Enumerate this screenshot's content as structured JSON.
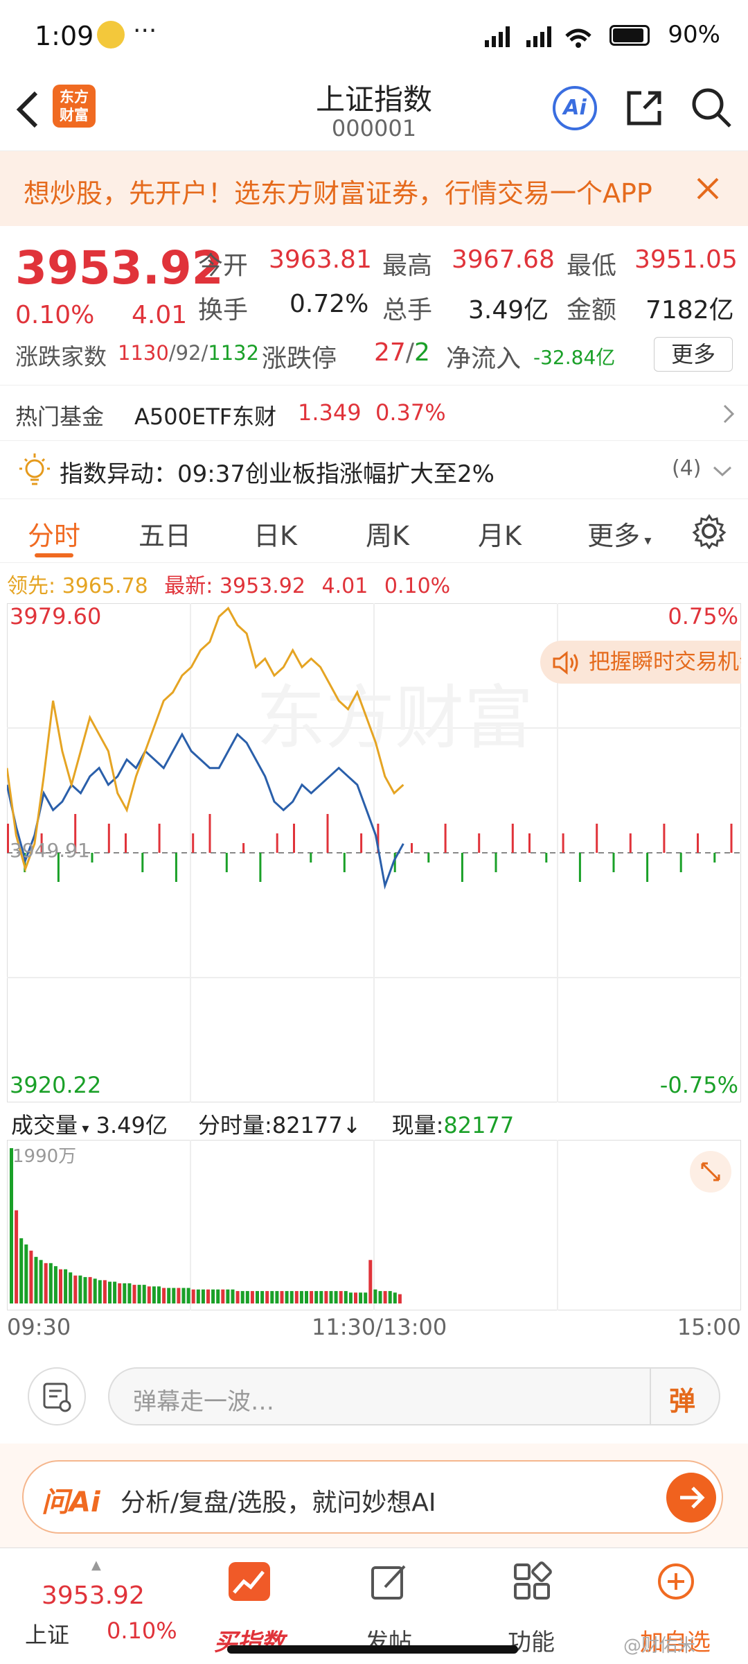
{
  "status_bar": {
    "time": "1:09",
    "dots": "···",
    "battery": "90%"
  },
  "header": {
    "back_icon": "chevron-left-icon",
    "logo_text": "东方\n财富",
    "title": "上证指数",
    "code": "000001",
    "ai_label": "Ai"
  },
  "banner": {
    "text": "想炒股，先开户！选东方财富证券，行情交易一个APP",
    "close_icon": "close-icon"
  },
  "quote": {
    "price": "3953.92",
    "change_pct": "0.10%",
    "change": "4.01",
    "open_label": "今开",
    "open": "3963.81",
    "high_label": "最高",
    "high": "3967.68",
    "low_label": "最低",
    "low": "3951.05",
    "turnover_label": "换手",
    "turnover": "0.72%",
    "volume_label": "总手",
    "volume": "3.49亿",
    "amount_label": "金额",
    "amount": "7182亿",
    "breadth_label": "涨跌家数",
    "up_count": "1130",
    "flat_count": "92",
    "down_count": "1132",
    "limit_label": "涨跌停",
    "limit_up": "27",
    "limit_down": "2",
    "netflow_label": "净流入",
    "netflow": "-32.84亿",
    "more_button": "更多"
  },
  "fund": {
    "label": "热门基金",
    "name": "A500ETF东财",
    "price": "1.349",
    "pct": "0.37%"
  },
  "alert": {
    "label": "指数异动",
    "text": "09:37创业板指涨幅扩大至2%",
    "count": "(4)"
  },
  "tabs": [
    {
      "label": "分时",
      "active": true
    },
    {
      "label": "五日"
    },
    {
      "label": "日K"
    },
    {
      "label": "周K"
    },
    {
      "label": "月K"
    },
    {
      "label": "更多"
    }
  ],
  "chart_info": {
    "lead_label": "领先:",
    "lead_value": "3965.78",
    "latest_label": "最新:",
    "latest_value": "3953.92",
    "change": "4.01",
    "pct": "0.10%"
  },
  "chart_data": {
    "type": "line",
    "y_max_label": "3979.60",
    "y_min_label": "3920.22",
    "pct_max_label": "0.75%",
    "pct_min_label": "-0.75%",
    "baseline_label": "3949.91",
    "ylim": [
      3920.22,
      3979.6
    ],
    "x_labels": [
      "09:30",
      "11:30/13:00",
      "15:00"
    ],
    "watermark": "东方财富",
    "series": [
      {
        "color": "#2a5faa",
        "values": [
          3958,
          3953,
          3949,
          3952,
          3957,
          3955,
          3956,
          3958,
          3957,
          3959,
          3960,
          3958,
          3959,
          3961,
          3960,
          3962,
          3961,
          3960,
          3962,
          3964,
          3962,
          3961,
          3960,
          3960,
          3962,
          3964,
          3963,
          3961,
          3959,
          3956,
          3955,
          3956,
          3958,
          3957,
          3958,
          3959,
          3960,
          3959,
          3958,
          3955,
          3952,
          3946,
          3949,
          3951
        ]
      },
      {
        "color": "#e5a423",
        "values": [
          3960,
          3952,
          3948,
          3951,
          3959,
          3968,
          3962,
          3958,
          3962,
          3966,
          3964,
          3962,
          3957,
          3955,
          3959,
          3962,
          3965,
          3968,
          3969,
          3971,
          3972,
          3974,
          3975,
          3978,
          3979,
          3977,
          3976,
          3972,
          3973,
          3971,
          3972,
          3974,
          3972,
          3973,
          3972,
          3970,
          3968,
          3967,
          3969,
          3966,
          3963,
          3959,
          3957,
          3958
        ]
      }
    ],
    "flow_bars": [
      3,
      -2,
      2,
      -3,
      4,
      -1,
      3,
      2,
      -2,
      3,
      -3,
      2,
      4,
      -2,
      1,
      -3,
      2,
      3,
      -1,
      4,
      -2,
      2,
      3,
      -2,
      1,
      -1,
      3,
      -3,
      2,
      -2,
      3,
      2,
      -1,
      2,
      -3,
      3,
      -2,
      2,
      -3,
      3,
      -2,
      2,
      -1,
      3
    ],
    "chart_button": "把握瞬时交易机会"
  },
  "volume": {
    "label": "成交量",
    "total": "3.49亿",
    "tick_label": "分时量:",
    "tick_value": "82177↓",
    "now_label": "现量:",
    "now_value": "82177",
    "scale_label": "1990万",
    "bars": [
      100,
      60,
      42,
      38,
      34,
      30,
      28,
      26,
      26,
      24,
      22,
      22,
      20,
      18,
      18,
      17,
      17,
      16,
      15,
      15,
      14,
      14,
      13,
      13,
      13,
      12,
      12,
      12,
      11,
      11,
      11,
      10,
      10,
      10,
      10,
      10,
      10,
      9,
      9,
      9,
      9,
      9,
      9,
      9,
      9,
      9,
      8,
      8,
      8,
      8,
      8,
      8,
      8,
      8,
      8,
      8,
      8,
      8,
      8,
      8,
      8,
      8,
      8,
      8,
      8,
      8,
      8,
      8,
      8,
      7,
      7,
      7,
      7,
      28,
      9,
      8,
      8,
      8,
      7,
      6
    ]
  },
  "comment": {
    "placeholder": "弹幕走一波…",
    "danmu_label": "弹"
  },
  "ai_bar": {
    "logo": "问Ai",
    "text": "分析/复盘/选股，就问妙想AI"
  },
  "bottom_nav": {
    "index_price": "3953.92",
    "index_name": "上证",
    "index_pct": "0.10%",
    "items": [
      {
        "label": "买指数"
      },
      {
        "label": "发帖"
      },
      {
        "label": "功能"
      },
      {
        "label": "加自选"
      }
    ]
  },
  "watermark": "@财佑米"
}
